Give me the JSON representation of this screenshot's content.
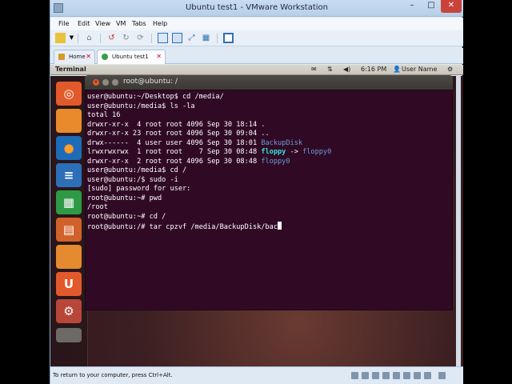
{
  "window": {
    "title": "Ubuntu test1 - VMware Workstation",
    "min_label": "–",
    "max_label": "□",
    "close_label": "✕"
  },
  "menu": [
    "File",
    "Edit",
    "View",
    "VM",
    "Tabs",
    "Help"
  ],
  "tabs": [
    {
      "label": "Home"
    },
    {
      "label": "Ubuntu test1"
    }
  ],
  "panel": {
    "title": "Terminal",
    "time": "6:16 PM",
    "user": "User Name"
  },
  "terminal": {
    "title": "root@ubuntu: /",
    "lines": [
      "user@ubuntu:~/Desktop$ cd /media/",
      "user@ubuntu:/media$ ls -la",
      "total 16",
      "drwxr-xr-x  4 root root 4096 Sep 30 18:14 .",
      "drwxr-xr-x 23 root root 4096 Sep 30 09:04 ..",
      "drwx------  4 user user 4096 Sep 30 18:01 ",
      "lrwxrwxrwx  1 root root    7 Sep 30 08:48 ",
      "drwxr-xr-x  2 root root 4096 Sep 30 08:48 ",
      "user@ubuntu:/media$ cd /",
      "user@ubuntu:/$ sudo -i",
      "[sudo] password for user:",
      "root@ubuntu:~# pwd",
      "/root",
      "root@ubuntu:~# cd /",
      "root@ubuntu:/# tar cpzvf /media/BackupDisk/bac"
    ],
    "entries": {
      "backupdisk": "BackupDisk",
      "floppy_link": "floppy",
      "arrow": " -> ",
      "floppy_target": "floppy0",
      "floppy0": "floppy0"
    }
  },
  "status": {
    "text": "To return to your computer, press Ctrl+Alt."
  },
  "launcher": {
    "items": [
      "ubuntu-home",
      "files",
      "firefox",
      "writer",
      "calc",
      "impress",
      "software-center",
      "ubuntu-one",
      "settings"
    ],
    "ubuntu_one_label": "U"
  },
  "colors": {
    "terminal_bg": "#300a24",
    "dir_blue": "#6e9bd8",
    "link_cyan": "#34e2e2",
    "ubuntu_orange": "#e25a2b"
  }
}
